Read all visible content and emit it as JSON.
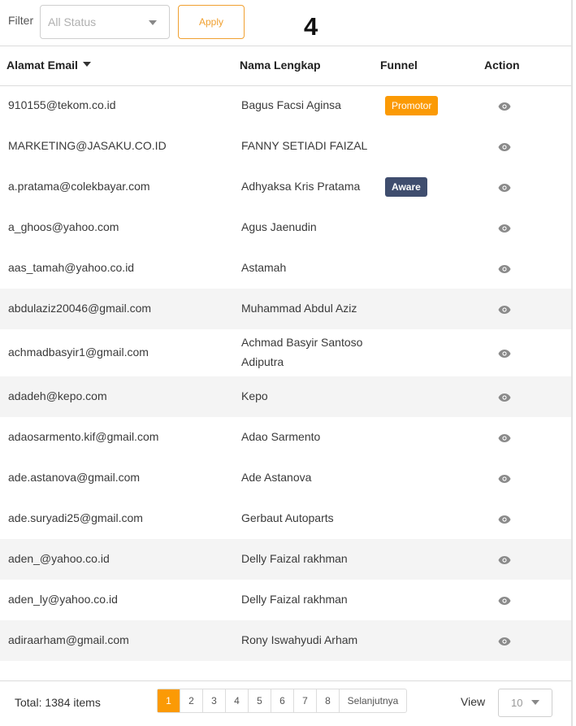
{
  "filter": {
    "label": "Filter",
    "status_placeholder": "All Status",
    "apply_label": "Apply"
  },
  "badge_number": "4",
  "table": {
    "columns": [
      "Alamat Email",
      "Nama Lengkap",
      "Funnel",
      "Action"
    ],
    "rows": [
      {
        "email": "910155@tekom.co.id",
        "name": "Bagus Facsi Aginsa",
        "funnel": "Promotor"
      },
      {
        "email": "MARKETING@JASAKU.CO.ID",
        "name": "FANNY SETIADI FAIZAL",
        "funnel": ""
      },
      {
        "email": "a.pratama@colekbayar.com",
        "name": "Adhyaksa Kris Pratama",
        "funnel": "Aware"
      },
      {
        "email": "a_ghoos@yahoo.com",
        "name": "Agus Jaenudin",
        "funnel": ""
      },
      {
        "email": "aas_tamah@yahoo.co.id",
        "name": "Astamah",
        "funnel": ""
      },
      {
        "email": "abdulaziz20046@gmail.com",
        "name": "Muhammad Abdul Aziz",
        "funnel": ""
      },
      {
        "email": "achmadbasyir1@gmail.com",
        "name": "Achmad Basyir Santoso Adiputra",
        "funnel": ""
      },
      {
        "email": "adadeh@kepo.com",
        "name": "Kepo",
        "funnel": ""
      },
      {
        "email": "adaosarmento.kif@gmail.com",
        "name": "Adao Sarmento",
        "funnel": ""
      },
      {
        "email": "ade.astanova@gmail.com",
        "name": "Ade Astanova",
        "funnel": ""
      },
      {
        "email": "ade.suryadi25@gmail.com",
        "name": "Gerbaut Autoparts",
        "funnel": ""
      },
      {
        "email": "aden_@yahoo.co.id",
        "name": "Delly Faizal rakhman",
        "funnel": ""
      },
      {
        "email": "aden_ly@yahoo.co.id",
        "name": "Delly Faizal rakhman",
        "funnel": ""
      },
      {
        "email": "adiraarham@gmail.com",
        "name": "Rony Iswahyudi Arham",
        "funnel": ""
      }
    ],
    "action_icon": "eye-icon"
  },
  "footer": {
    "total": "Total: 1384 items",
    "pages": [
      "1",
      "2",
      "3",
      "4",
      "5",
      "6",
      "7",
      "8"
    ],
    "active_page": "1",
    "next_label": "Selanjutnya",
    "view_label": "View",
    "view_value": "10"
  },
  "colors": {
    "accent": "#fb9a05",
    "aware_badge": "#3f4d6e",
    "row_alt": "#f4f4f4"
  }
}
